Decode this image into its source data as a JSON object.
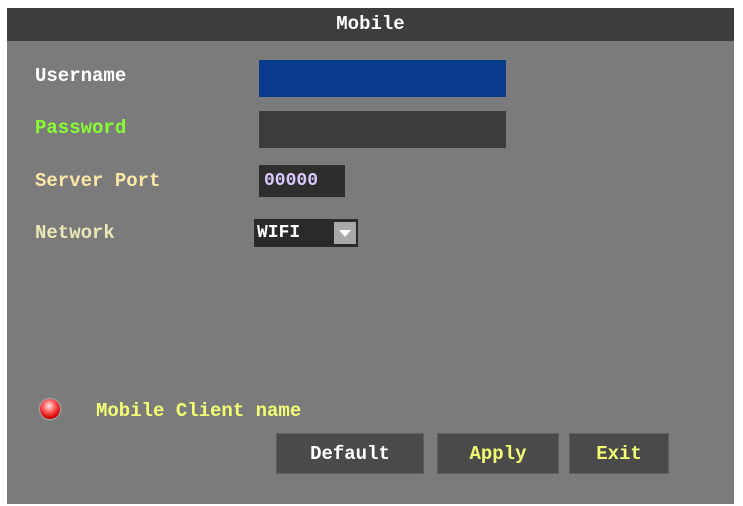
{
  "window": {
    "title": "Mobile"
  },
  "form": {
    "username": {
      "label": "Username",
      "value": ""
    },
    "password": {
      "label": "Password",
      "value": ""
    },
    "server_port": {
      "label": "Server Port",
      "value": "00000"
    },
    "network": {
      "label": "Network",
      "selected": "WIFI"
    }
  },
  "status": {
    "indicator_color": "#d40000",
    "client_name": "Mobile Client name"
  },
  "buttons": {
    "default": "Default",
    "apply": "Apply",
    "exit": "Exit"
  },
  "colors": {
    "panel_bg": "#7b7b7b",
    "titlebar_bg": "#3d3d3d",
    "username_label": "#ffffff",
    "password_label": "#88ff33",
    "server_port_label": "#fde8a8",
    "network_label": "#eae7b6",
    "client_name": "#f4ff73",
    "username_field": "#0a3a8c",
    "password_field": "#3c3c3c"
  },
  "icons": {
    "status_indicator": "red-circle-icon",
    "dropdown": "chevron-down-icon"
  }
}
